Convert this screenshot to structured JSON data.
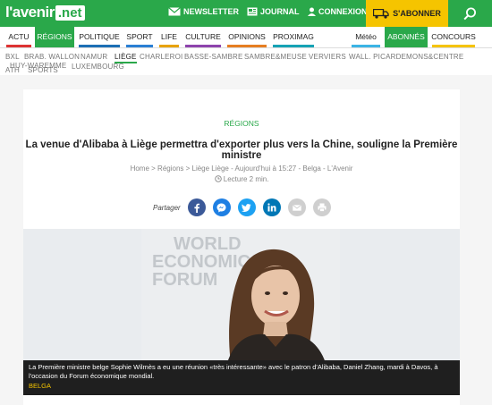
{
  "header": {
    "logo_left": "l'avenir",
    "logo_right": ".net",
    "newsletter": "NEWSLETTER",
    "journal": "JOURNAL",
    "connexion": "CONNEXION",
    "abonner": "S'ABONNER"
  },
  "mainnav": {
    "items": [
      "ACTU",
      "RÉGIONS",
      "POLITIQUE",
      "SPORT",
      "LIFE",
      "CULTURE",
      "OPINIONS",
      "PROXIMAG",
      "Météo",
      "ABONNÉS",
      "CONCOURS"
    ]
  },
  "subnav": {
    "items": [
      "BXL",
      "BRAB. WALLON",
      "NAMUR",
      "LIÈGE",
      "CHARLEROI",
      "BASSE-SAMBRE",
      "SAMBRE&MEUSE",
      "VERVIERS",
      "WALL. PICARDE",
      "MONS&CENTRE",
      "HUY-WAREMME",
      "LUXEMBOURG",
      "ATH",
      "SPORTS"
    ]
  },
  "article": {
    "category": "RÉGIONS",
    "title": "La venue d'Alibaba à Liège permettra d'exporter plus vers la Chine, souligne la Première ministre",
    "meta": "Home > Régions > Liège Liège - Aujourd'hui à 15:27 - Belga - L'Avenir",
    "reading": "Lecture 2 min.",
    "share_label": "Partager",
    "photo_text": [
      "WORLD",
      "ECONOMIC",
      "FORUM"
    ],
    "caption": "La Première ministre belge Sophie Wilmès a eu une réunion «très intéressante» avec le patron d'Alibaba, Daniel Zhang, mardi à Davos, à l'occasion du Forum économique mondial.",
    "credit": "BELGA"
  },
  "colors": {
    "brand_green": "#2aa84a",
    "abonner_yellow": "#f5c400"
  }
}
